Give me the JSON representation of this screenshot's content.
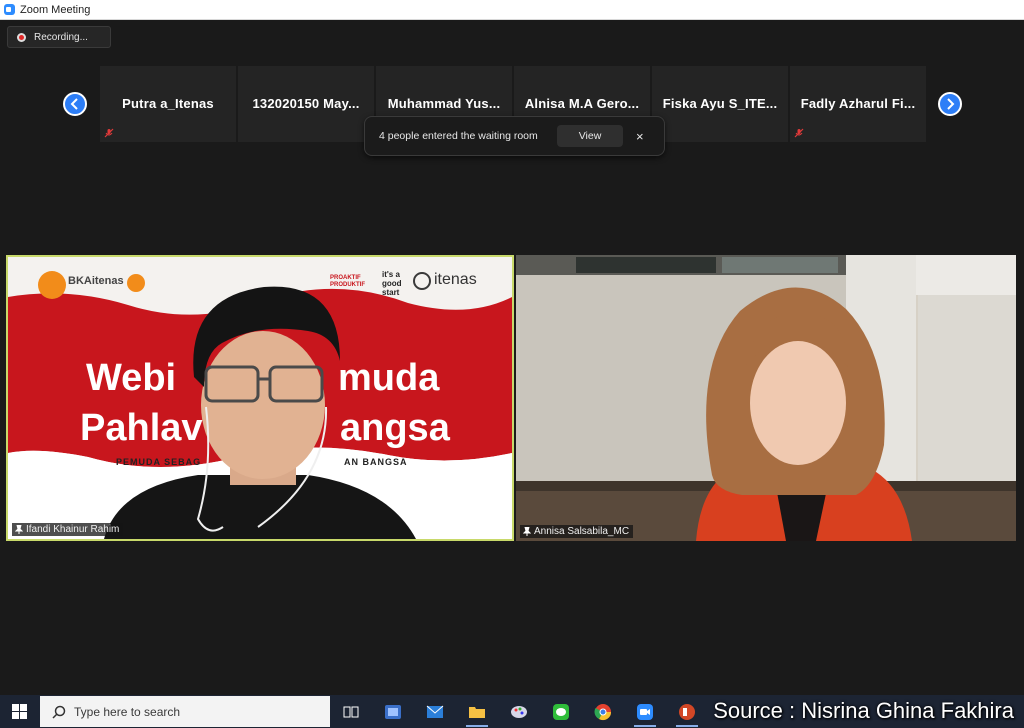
{
  "window": {
    "title": "Zoom Meeting"
  },
  "recording": {
    "label": "Recording..."
  },
  "participants_strip": [
    {
      "name": "Putra a_Itenas",
      "muted": true
    },
    {
      "name": "132020150 May...",
      "muted": true
    },
    {
      "name": "Muhammad Yus...",
      "muted": true
    },
    {
      "name": "Alnisa M.A Gero...",
      "muted": true
    },
    {
      "name": "Fiska Ayu S_ITE...",
      "muted": true
    },
    {
      "name": "Fadly Azharul Fi...",
      "muted": true
    }
  ],
  "waiting_room": {
    "message": "4 people entered the waiting room",
    "view_label": "View",
    "close_symbol": "×"
  },
  "videos": [
    {
      "name": "Ifandi Khainur Rahim",
      "background": {
        "logo_left": "BKAitenas",
        "logo_right_1": "PROAKTIF PRODUKTIF",
        "logo_right_2": "it's a good start",
        "logo_right_3": "itenas",
        "headline_1": "Webi",
        "headline_1b": "muda",
        "headline_2": "Pahlav",
        "headline_2b": "angsa",
        "subline_a": "PEMUDA SEBAG",
        "subline_b": "AN BANGSA"
      }
    },
    {
      "name": "Annisa Salsabila_MC"
    }
  ],
  "taskbar": {
    "search_placeholder": "Type here to search",
    "watermark": "Source : Nisrina Ghina Fakhira"
  },
  "colors": {
    "accent": "#2d7ef7",
    "active_speaker": "#c8d96a",
    "banner_red": "#c8161d"
  }
}
